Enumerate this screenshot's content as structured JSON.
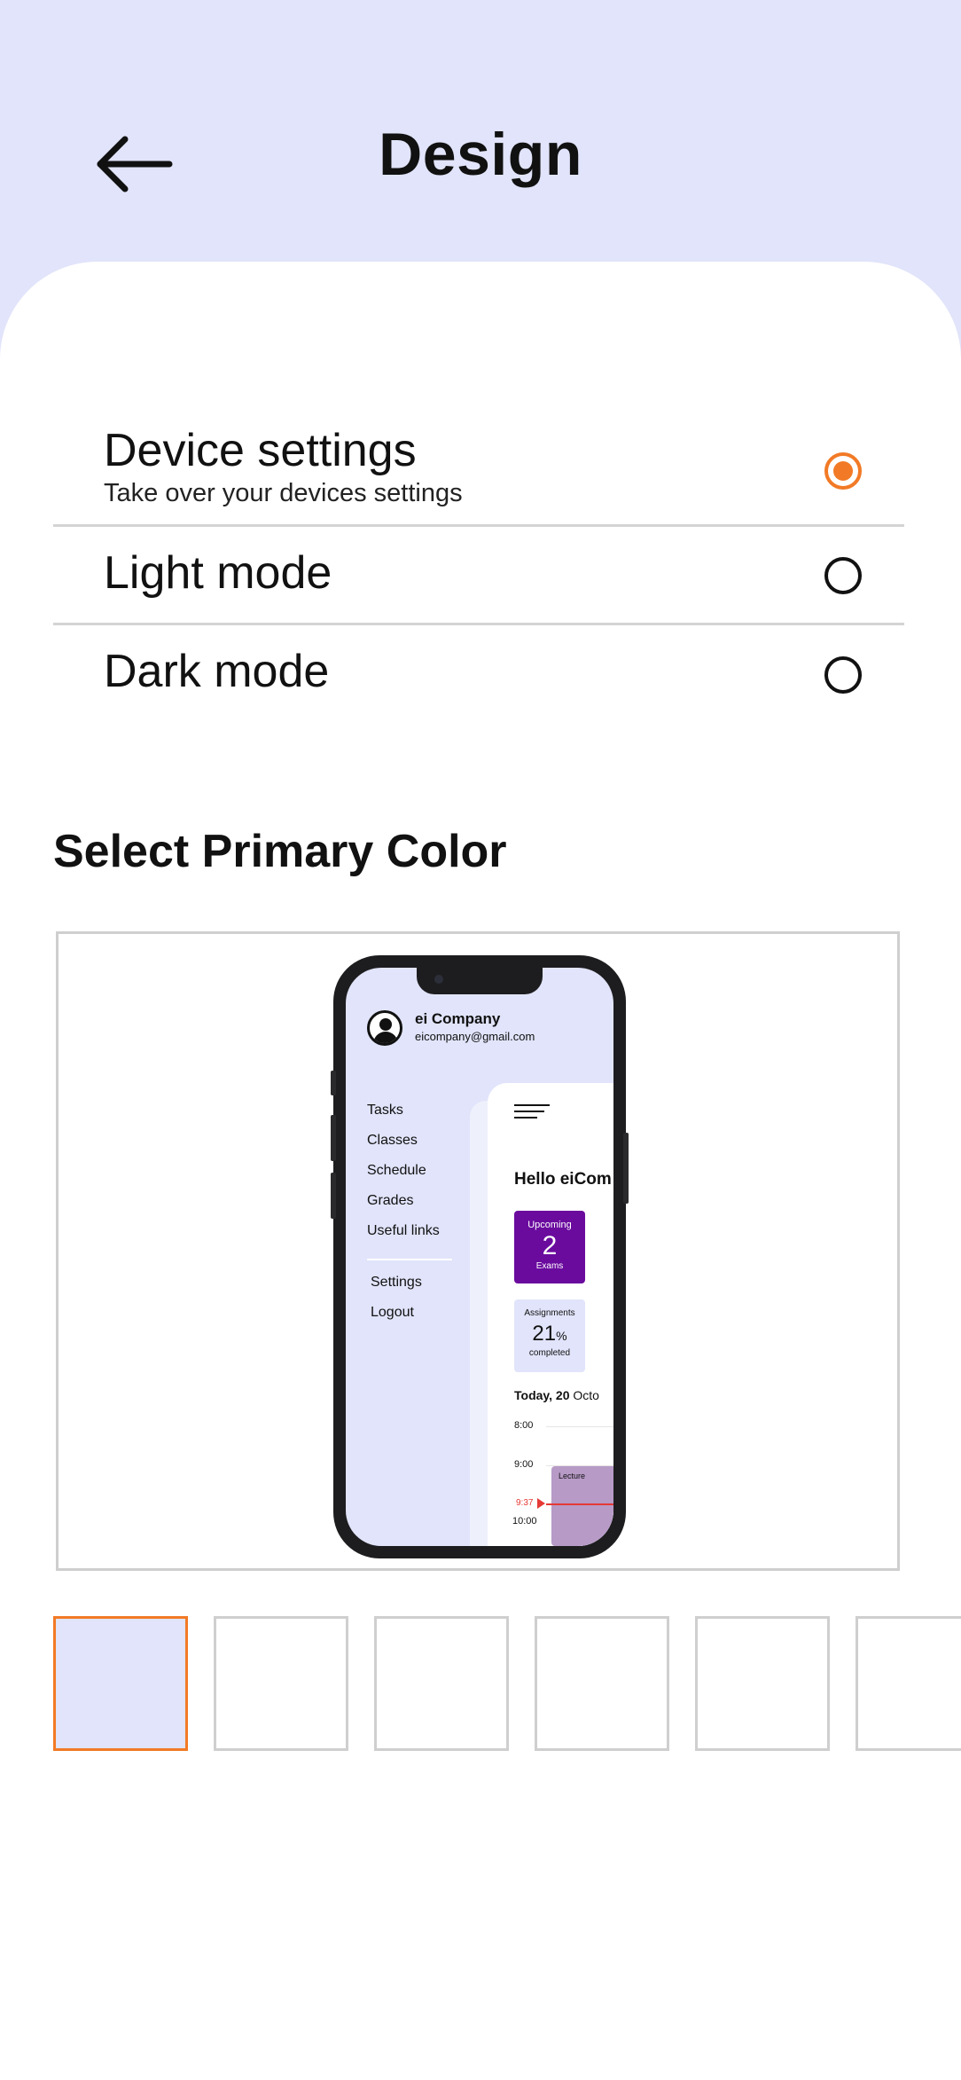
{
  "header": {
    "title": "Design",
    "back_icon": "arrow-left-icon",
    "background_color": "#e1e4fa"
  },
  "theme_options": [
    {
      "label": "Device settings",
      "subtitle": "Take over your devices settings",
      "selected": true
    },
    {
      "label": "Light mode",
      "subtitle": "",
      "selected": false
    },
    {
      "label": "Dark mode",
      "subtitle": "",
      "selected": false
    }
  ],
  "accent_color": "#f27a26",
  "primary_color_section": {
    "title": "Select Primary Color",
    "preview": {
      "company": "ei Company",
      "email": "eicompany@gmail.com",
      "menu": [
        "Tasks",
        "Classes",
        "Schedule",
        "Grades",
        "Useful links"
      ],
      "secondary_menu": [
        "Settings",
        "Logout"
      ],
      "greeting": "Hello eiCom",
      "upcoming": {
        "top": "Upcoming",
        "number": "2",
        "bottom": "Exams"
      },
      "assignments": {
        "top": "Assignments",
        "number": "21",
        "unit": "%",
        "bottom": "completed"
      },
      "today_bold": "Today, 20",
      "today_rest": " Octo",
      "times": [
        "8:00",
        "9:00",
        "9:37",
        "10:00"
      ],
      "lecture_label": "Lecture",
      "upcoming_card_color": "#6a0b9e",
      "lecture_color": "#b79ac6"
    },
    "swatches": [
      {
        "color": "#e1e4fa",
        "selected": true
      },
      {
        "color": "#ffffff",
        "selected": false
      },
      {
        "color": "#ffffff",
        "selected": false
      },
      {
        "color": "#ffffff",
        "selected": false
      },
      {
        "color": "#ffffff",
        "selected": false
      },
      {
        "color": "#ffffff",
        "selected": false
      }
    ]
  }
}
